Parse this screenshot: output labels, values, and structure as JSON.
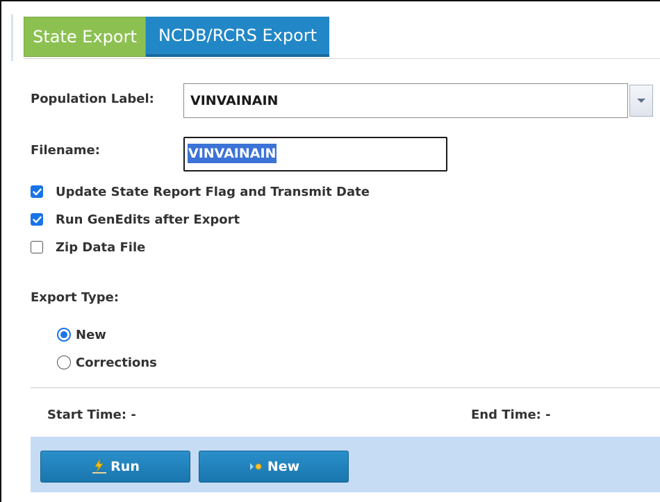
{
  "tabs": [
    {
      "label": "State Export",
      "active": true,
      "color": "#8cc152"
    },
    {
      "label": "NCDB/RCRS Export",
      "active": false,
      "color": "#2287c6"
    }
  ],
  "form": {
    "population_label": "Population Label:",
    "population_value": "VINVAINAIN",
    "filename_label": "Filename:",
    "filename_value": "VINVAINAIN"
  },
  "options": [
    {
      "label": "Update State Report Flag and Transmit Date",
      "checked": true
    },
    {
      "label": "Run GenEdits after Export",
      "checked": true
    },
    {
      "label": "Zip Data File",
      "checked": false
    }
  ],
  "export_type": {
    "label": "Export Type:",
    "choices": [
      {
        "label": "New",
        "selected": true
      },
      {
        "label": "Corrections",
        "selected": false
      }
    ]
  },
  "times": {
    "start": "Start Time: -",
    "end": "End Time: -"
  },
  "buttons": {
    "run": "Run",
    "new": "New"
  },
  "colors": {
    "accent_blue": "#1a73e8",
    "button_bar": "#c6dcf5"
  }
}
